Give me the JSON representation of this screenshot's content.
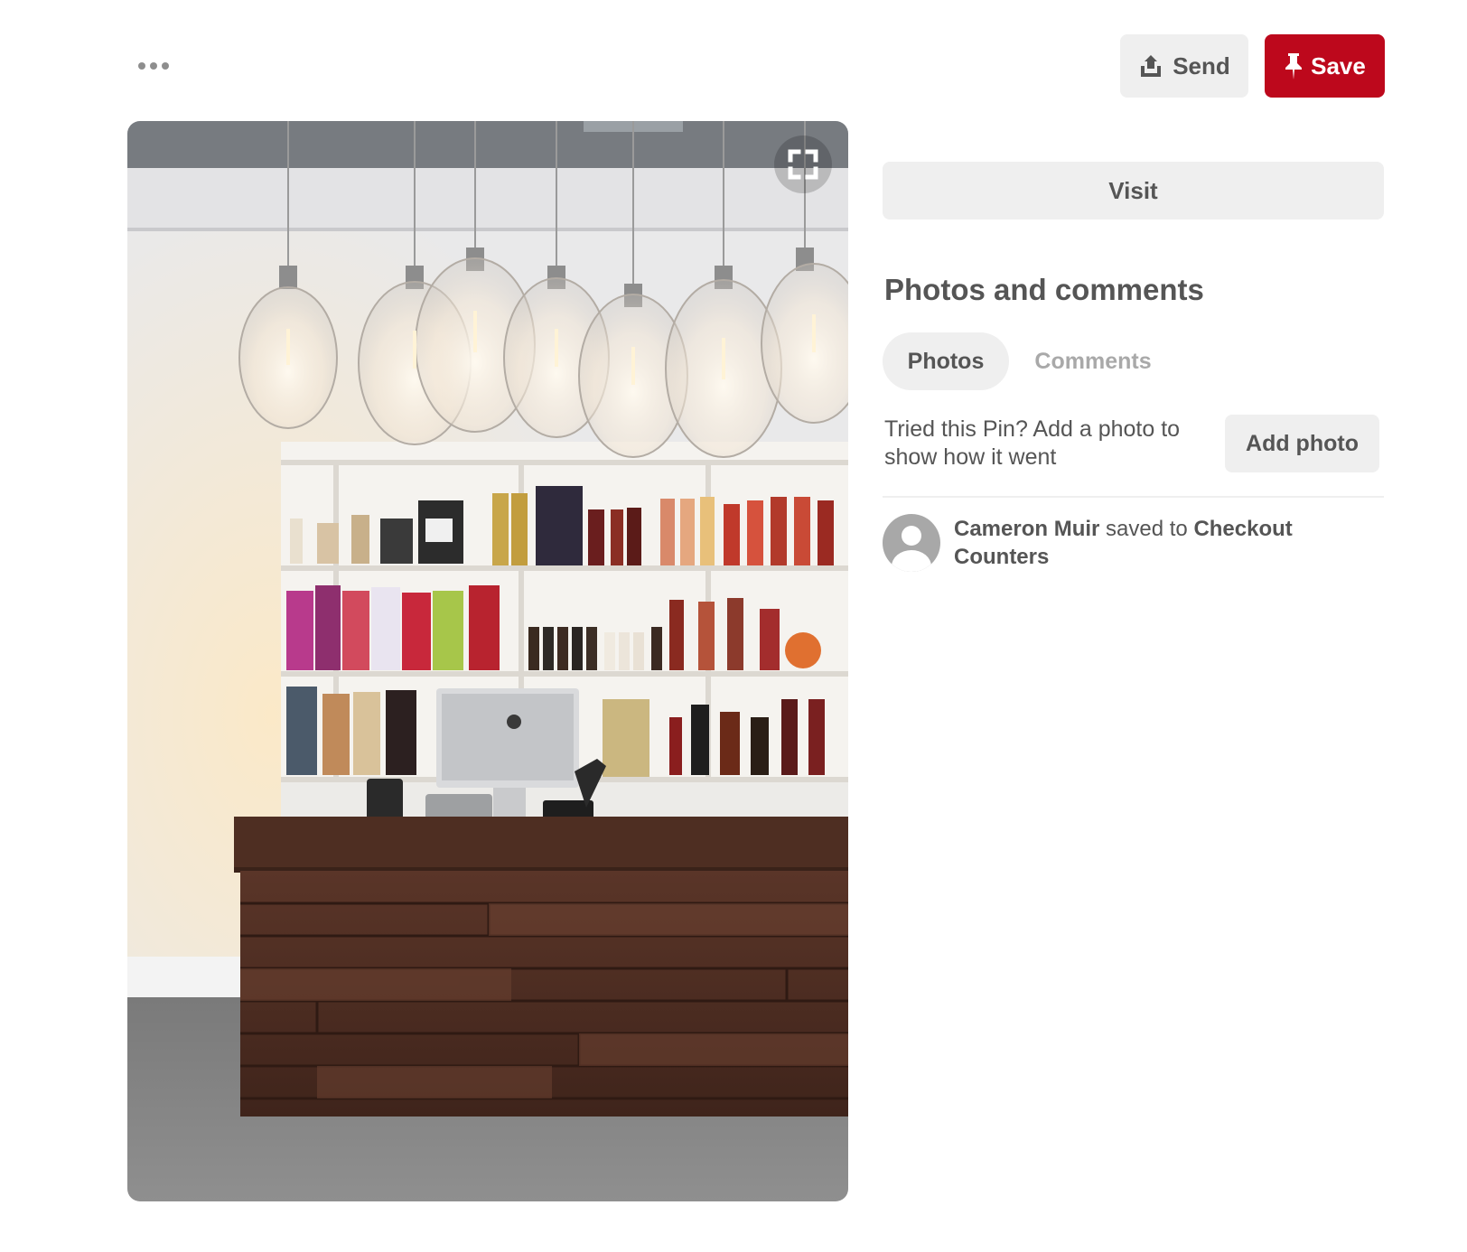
{
  "header": {
    "more_icon": "ellipsis-icon",
    "send_label": "Send",
    "send_icon": "share-upload-icon",
    "save_label": "Save",
    "save_icon": "pushpin-icon"
  },
  "pin": {
    "expand_icon": "expand-fullscreen-icon"
  },
  "side": {
    "visit_label": "Visit",
    "section_title": "Photos and comments",
    "tabs": [
      {
        "label": "Photos",
        "active": true
      },
      {
        "label": "Comments",
        "active": false
      }
    ],
    "tried_text": "Tried this Pin? Add a photo to show how it went",
    "add_photo_label": "Add photo",
    "activity": {
      "user": "Cameron Muir",
      "verb": "saved to",
      "board": "Checkout Counters"
    }
  },
  "colors": {
    "save_red": "#bd081c",
    "button_gray": "#efefef",
    "text_gray": "#555555",
    "inactive_tab": "#a9a9a9"
  }
}
